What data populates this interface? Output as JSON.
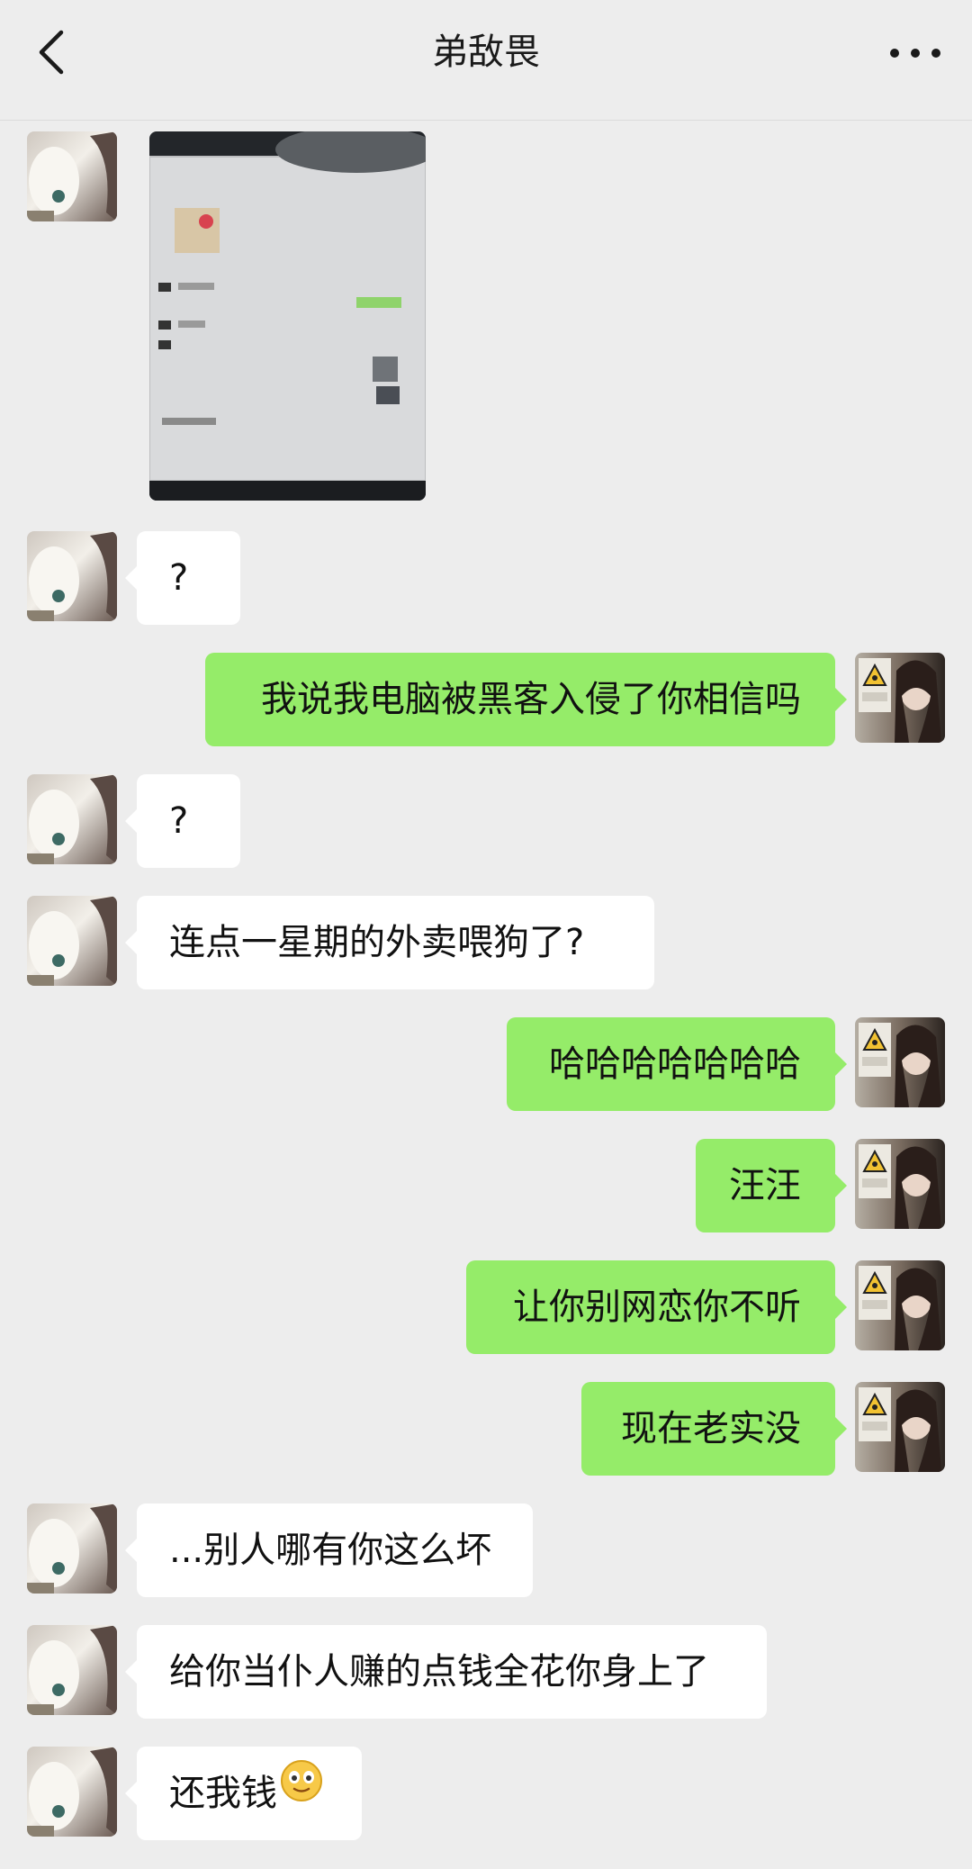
{
  "header": {
    "title": "弟敌畏"
  },
  "messages": [
    {
      "side": "left",
      "kind": "image"
    },
    {
      "side": "left",
      "text": "?"
    },
    {
      "side": "right",
      "text": "我说我电脑被黑客入侵了你相信吗"
    },
    {
      "side": "left",
      "text": "?"
    },
    {
      "side": "left",
      "text": "连点一星期的外卖喂狗了?"
    },
    {
      "side": "right",
      "text": "哈哈哈哈哈哈哈"
    },
    {
      "side": "right",
      "text": "汪汪"
    },
    {
      "side": "right",
      "text": "让你别网恋你不听"
    },
    {
      "side": "right",
      "text": "现在老实没"
    },
    {
      "side": "left",
      "text": "...别人哪有你这么坏"
    },
    {
      "side": "left",
      "text": "给你当仆人赚的点钱全花你身上了"
    },
    {
      "side": "left",
      "text": "还我钱",
      "emoji": "smiling-face-emoji"
    }
  ],
  "colors": {
    "background": "#ededed",
    "bubble_self": "#95ec69",
    "bubble_other": "#ffffff"
  }
}
